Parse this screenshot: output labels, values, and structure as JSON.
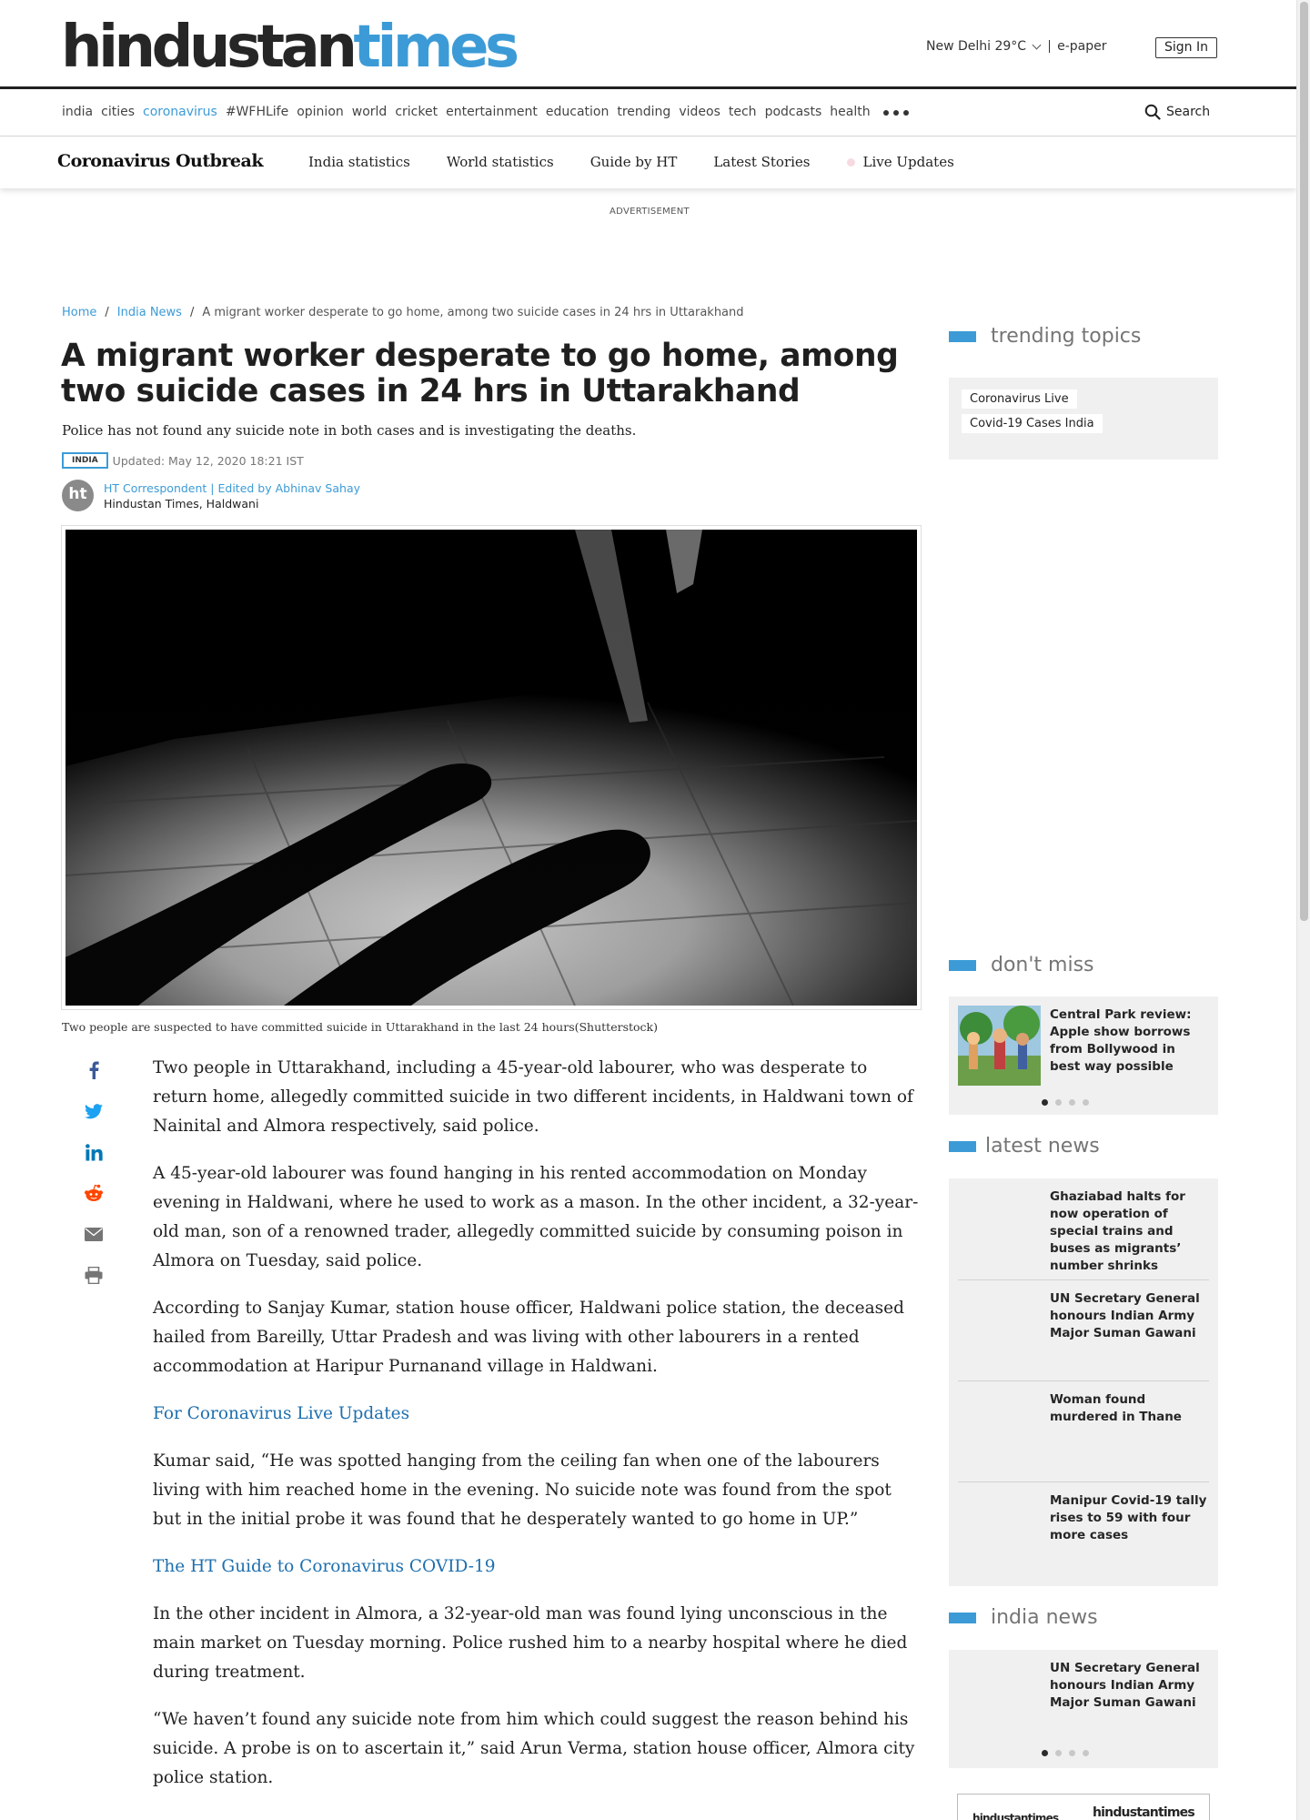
{
  "masthead": {
    "logo_part1": "hindustan",
    "logo_part2": "times",
    "weather": "New Delhi 29°C",
    "epaper": "e-paper",
    "signin": "Sign In"
  },
  "nav": {
    "items": [
      "india",
      "cities",
      "coronavirus",
      "#WFHLife",
      "opinion",
      "world",
      "cricket",
      "entertainment",
      "education",
      "trending",
      "videos",
      "tech",
      "podcasts",
      "health"
    ],
    "active": "coronavirus",
    "search_label": "Search"
  },
  "subnav": {
    "brand": "Coronavirus Outbreak",
    "items": [
      "India statistics",
      "World statistics",
      "Guide by HT",
      "Latest Stories",
      "Live Updates"
    ]
  },
  "advert_label": "ADVERTISEMENT",
  "breadcrumb": {
    "home": "Home",
    "section": "India News",
    "current": "A migrant worker desperate to go home, among two suicide cases in 24 hrs in Uttarakhand"
  },
  "article": {
    "headline": "A migrant worker desperate to go home, among two suicide cases in 24 hrs in Uttarakhand",
    "summary": "Police has not found any suicide note in both cases and is investigating the deaths.",
    "tag": "INDIA",
    "updated": "Updated: May 12, 2020 18:21 IST",
    "author_avatar": "ht",
    "author": "HT Correspondent | Edited by Abhinav Sahay",
    "location": "Hindustan Times, Haldwani",
    "caption": "Two people are suspected to have committed suicide in Uttarakhand in the last 24 hours(Shutterstock)",
    "paragraphs": [
      {
        "text": "Two people in Uttarakhand, including a 45-year-old labourer, who was desperate to return home, allegedly committed suicide in two different incidents, in Haldwani town of Nainital and Almora respectively, said police.",
        "link": false
      },
      {
        "text": "A 45-year-old labourer was found hanging in his rented accommodation on Monday evening in Haldwani, where he used to work as a mason. In the other incident, a 32-year-old man, son of a renowned trader, allegedly committed suicide by consuming poison in Almora on Tuesday, said police.",
        "link": false
      },
      {
        "text": "According to Sanjay Kumar, station house officer, Haldwani police station, the deceased hailed from Bareilly, Uttar Pradesh and was living with other labourers in a rented accommodation at Haripur Purnanand village in Haldwani.",
        "link": false
      },
      {
        "text": "For Coronavirus Live Updates",
        "link": true
      },
      {
        "text": "Kumar said, “He was spotted hanging from the ceiling fan when one of the labourers living with him reached home in the evening. No suicide note was found from the spot but in the initial probe it was found that he desperately wanted to go home in UP.”",
        "link": false
      },
      {
        "text": "The HT Guide to Coronavirus COVID-19",
        "link": true
      },
      {
        "text": "In the other incident in Almora, a 32-year-old man was found lying unconscious in the main market on Tuesday morning. Police rushed him to a nearby hospital where he died during treatment.",
        "link": false
      },
      {
        "text": "“We haven’t found any suicide note from him which could suggest the reason behind his suicide. A probe is on to ascertain it,” said Arun Verma, station house officer, Almora city police station.",
        "link": false
      }
    ]
  },
  "share_icons": [
    "facebook-icon",
    "twitter-icon",
    "linkedin-icon",
    "reddit-icon",
    "email-icon",
    "print-icon"
  ],
  "sidebar": {
    "trending": {
      "title": "trending topics",
      "chips": [
        "Coronavirus Live",
        "Covid-19 Cases India"
      ]
    },
    "dont_miss": {
      "title": "don't miss",
      "story": "Central Park review: Apple show borrows from Bollywood in best way possible"
    },
    "latest": {
      "title": "latest news",
      "stories": [
        "Ghaziabad halts for now operation of special trains and buses as migrants’ number shrinks",
        "UN Secretary General honours Indian Army Major Suman Gawani",
        "Woman found murdered in Thane",
        "Manipur Covid-19 tally rises to 59 with four more cases"
      ]
    },
    "india": {
      "title": "india news",
      "story": "UN Secretary General honours Indian Army Major Suman Gawani"
    },
    "bottom_ad": {
      "a": "hindustantimes",
      "b": "hindustantimes"
    }
  },
  "colors": {
    "brand_blue": "#3c9bd6",
    "link_blue": "#1d6fae",
    "text": "#212121"
  }
}
